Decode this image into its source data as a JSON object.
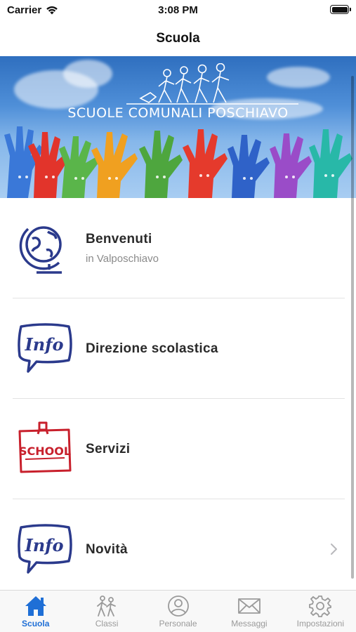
{
  "status_bar": {
    "carrier": "Carrier",
    "time": "3:08 PM"
  },
  "nav": {
    "title": "Scuola"
  },
  "banner": {
    "title": "SCUOLE COMUNALI POSCHIAVO"
  },
  "list": {
    "items": [
      {
        "label": "Benvenuti",
        "subtitle": "in Valposchiavo",
        "icon": "globe-icon"
      },
      {
        "label": "Direzione scolastica",
        "icon": "info-bubble-icon"
      },
      {
        "label": "Servizi",
        "icon": "school-sign-icon"
      },
      {
        "label": "Novità",
        "icon": "info-bubble-icon"
      }
    ]
  },
  "tabs": [
    {
      "label": "Scuola",
      "icon": "house-icon",
      "active": true
    },
    {
      "label": "Classi",
      "icon": "walking-people-icon"
    },
    {
      "label": "Personale",
      "icon": "person-circle-icon"
    },
    {
      "label": "Messaggi",
      "icon": "envelope-icon"
    },
    {
      "label": "Impostazioni",
      "icon": "gear-icon"
    }
  ],
  "colors": {
    "accent": "#1f6fd6",
    "icon_navy": "#2b3a8c",
    "icon_red": "#c8202c"
  }
}
